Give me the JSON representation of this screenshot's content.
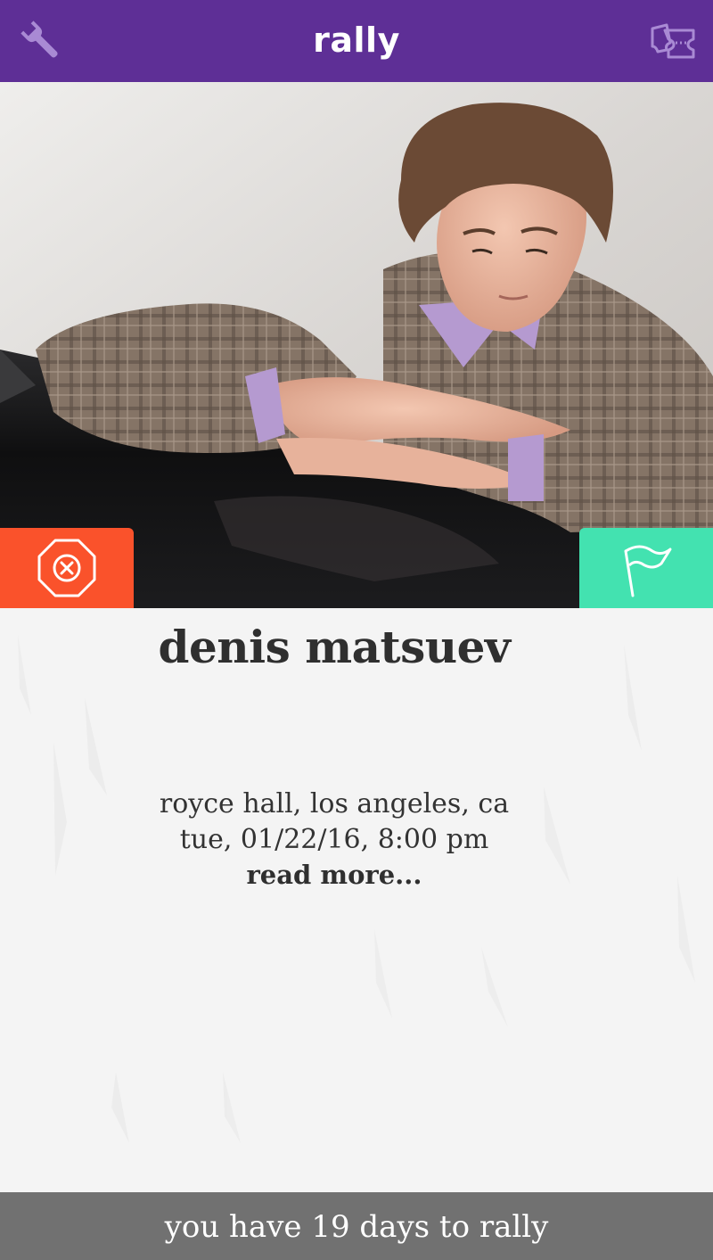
{
  "header": {
    "title": "rally",
    "left_icon": "wrench-icon",
    "right_icon": "tickets-icon",
    "bg_color": "#5e2f96"
  },
  "event": {
    "photo_description_icon": "artist-photo",
    "name": "denis matsuev",
    "venue": "royce hall, los angeles, ca",
    "datetime": "tue, 01/22/16, 8:00 pm",
    "read_more": "read more..."
  },
  "actions": {
    "pass_icon": "close-octagon-icon",
    "pass_color": "#fa522b",
    "rally_icon": "flag-icon",
    "rally_color": "#43e2b0"
  },
  "footer": {
    "text": "you have 19 days to rally"
  }
}
